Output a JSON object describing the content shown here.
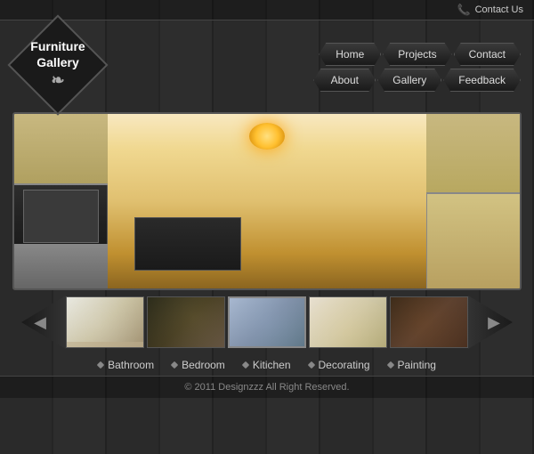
{
  "topBar": {
    "contactLabel": "Contact Us",
    "phoneIcon": "📞"
  },
  "header": {
    "logoLine1": "Furniture",
    "logoLine2": "Gallery",
    "swirlChar": "❧"
  },
  "nav": {
    "row1": [
      {
        "label": "Home",
        "id": "home"
      },
      {
        "label": "Projects",
        "id": "projects"
      },
      {
        "label": "Contact",
        "id": "contact"
      }
    ],
    "row2": [
      {
        "label": "About",
        "id": "about"
      },
      {
        "label": "Gallery",
        "id": "gallery"
      },
      {
        "label": "Feedback",
        "id": "feedback"
      }
    ]
  },
  "thumbnails": [
    {
      "id": "thumb-1",
      "alt": "Bathroom"
    },
    {
      "id": "thumb-2",
      "alt": "Bedroom"
    },
    {
      "id": "thumb-3",
      "alt": "Kitchen"
    },
    {
      "id": "thumb-4",
      "alt": "Decorating"
    },
    {
      "id": "thumb-5",
      "alt": "Painting"
    }
  ],
  "categories": [
    {
      "label": "Bathroom"
    },
    {
      "label": "Bedroom"
    },
    {
      "label": "Kitichen"
    },
    {
      "label": "Decorating"
    },
    {
      "label": "Painting"
    }
  ],
  "footer": {
    "copyright": "© 2011 Designzzz  All Right Reserved."
  }
}
